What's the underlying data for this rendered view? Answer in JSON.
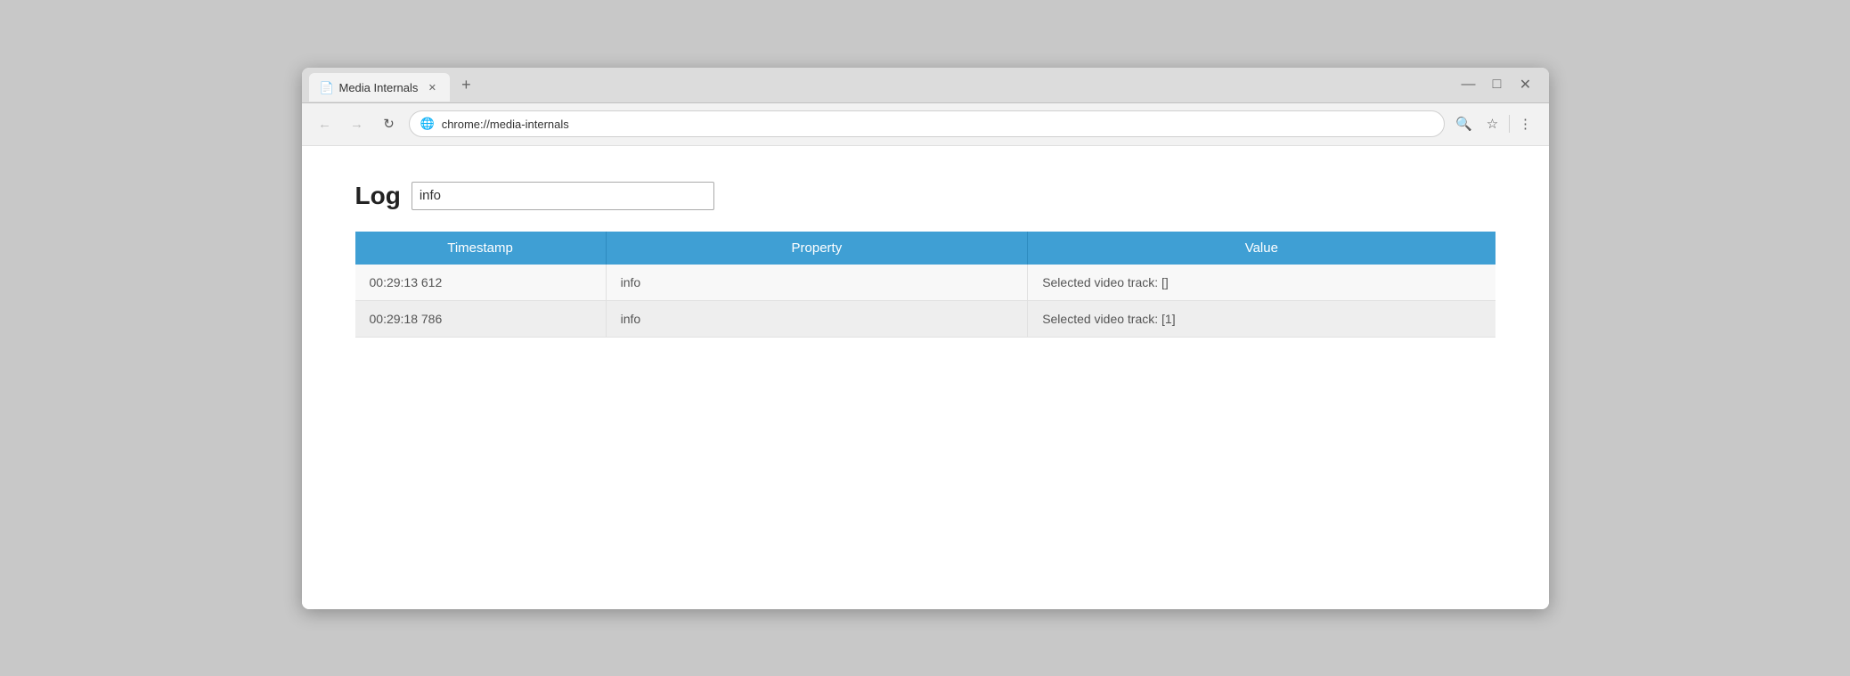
{
  "browser": {
    "title": "Media Internals",
    "url": "chrome://media-internals",
    "url_display": "chrome://media-internals",
    "nav": {
      "back_label": "←",
      "forward_label": "→",
      "reload_label": "↻"
    },
    "address_icon": "🌐",
    "window_controls": {
      "minimize": "—",
      "maximize": "□",
      "close": "✕"
    },
    "toolbar": {
      "search_label": "🔍",
      "star_label": "☆",
      "menu_label": "⋮"
    }
  },
  "page": {
    "log_label": "Log",
    "log_input_value": "info",
    "log_input_placeholder": "",
    "table": {
      "headers": [
        "Timestamp",
        "Property",
        "Value"
      ],
      "rows": [
        {
          "timestamp": "00:29:13 612",
          "property": "info",
          "value": "Selected video track: []"
        },
        {
          "timestamp": "00:29:18 786",
          "property": "info",
          "value": "Selected video track: [1]"
        }
      ]
    }
  }
}
